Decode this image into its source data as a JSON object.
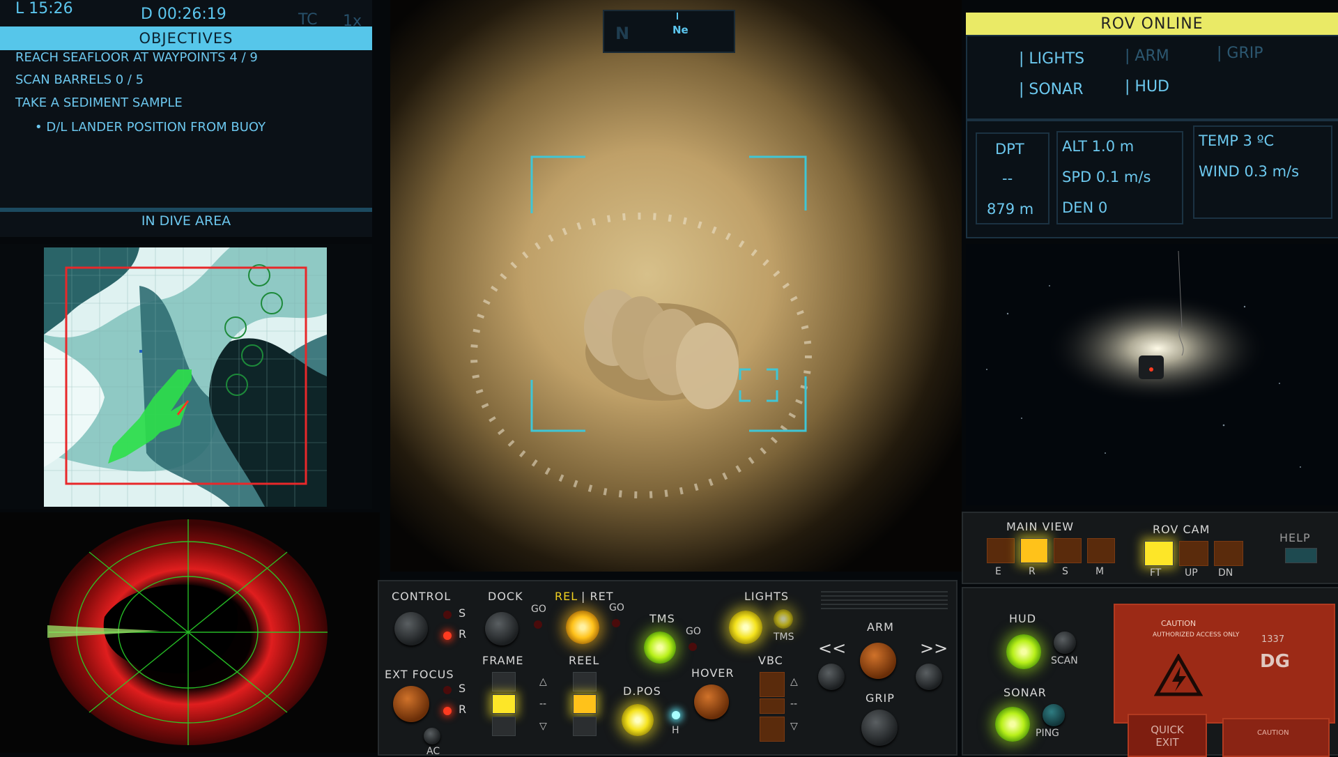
{
  "top_left": {
    "local_time": "L 15:26",
    "dive_time": "D 00:26:19",
    "tc_label": "TC",
    "speed_label": "1x",
    "objectives_title": "OBJECTIVES",
    "objectives": [
      "REACH SEAFLOOR AT WAYPOINTS 4 / 9",
      "SCAN BARRELS 0 / 5",
      "TAKE A SEDIMENT SAMPLE",
      "• D/L LANDER POSITION FROM BUOY"
    ],
    "area_status": "IN DIVE AREA"
  },
  "compass": {
    "north": "N",
    "heading": "Ne"
  },
  "right": {
    "status": "ROV ONLINE",
    "menu": {
      "lights": "| LIGHTS",
      "arm": "| ARM",
      "grip": "| GRIP",
      "sonar": "| SONAR",
      "hud": "| HUD"
    },
    "telemetry": {
      "dpt_label": "DPT",
      "dpt_mid": "--",
      "dpt_value": "879 m",
      "alt": "ALT 1.0 m",
      "spd": "SPD 0.1 m/s",
      "den": "DEN  0",
      "temp": "TEMP 3 ºC",
      "wind": "WIND 0.3 m/s"
    }
  },
  "control_panel": {
    "control": "CONTROL",
    "dock": "DOCK",
    "rel": "REL",
    "ret": "| RET",
    "go": "GO",
    "tms": "TMS",
    "lights": "LIGHTS",
    "s": "S",
    "r": "R",
    "ext_focus": "EXT FOCUS",
    "frame": "FRAME",
    "reel": "REEL",
    "dpos": "D.POS",
    "h": "H",
    "hover": "HOVER",
    "vbc": "VBC",
    "arm": "ARM",
    "grip": "GRIP",
    "prev": "<<",
    "next": ">>",
    "up": "△",
    "mid": "--",
    "down": "▽",
    "ac": "AC"
  },
  "view_panel": {
    "main_view": "MAIN VIEW",
    "rov_cam": "ROV CAM",
    "help": "HELP",
    "main_keys": [
      "E",
      "R",
      "S",
      "M"
    ],
    "cam_keys": [
      "FT",
      "UP",
      "DN"
    ]
  },
  "right_panel": {
    "hud": "HUD",
    "scan": "SCAN",
    "sonar": "SONAR",
    "ping": "PING",
    "caution": "CAUTION",
    "caution_sub": "AUTHORIZED ACCESS ONLY",
    "plate_number": "1337",
    "plate_code": "DG",
    "quick_exit": "QUICK EXIT"
  },
  "colors": {
    "hud_cyan": "#56c6ea",
    "status_yellow": "#eaea66",
    "minimap_border": "#e8282a",
    "sonar_red": "#d01818",
    "sonar_grid": "#2ad02a"
  }
}
